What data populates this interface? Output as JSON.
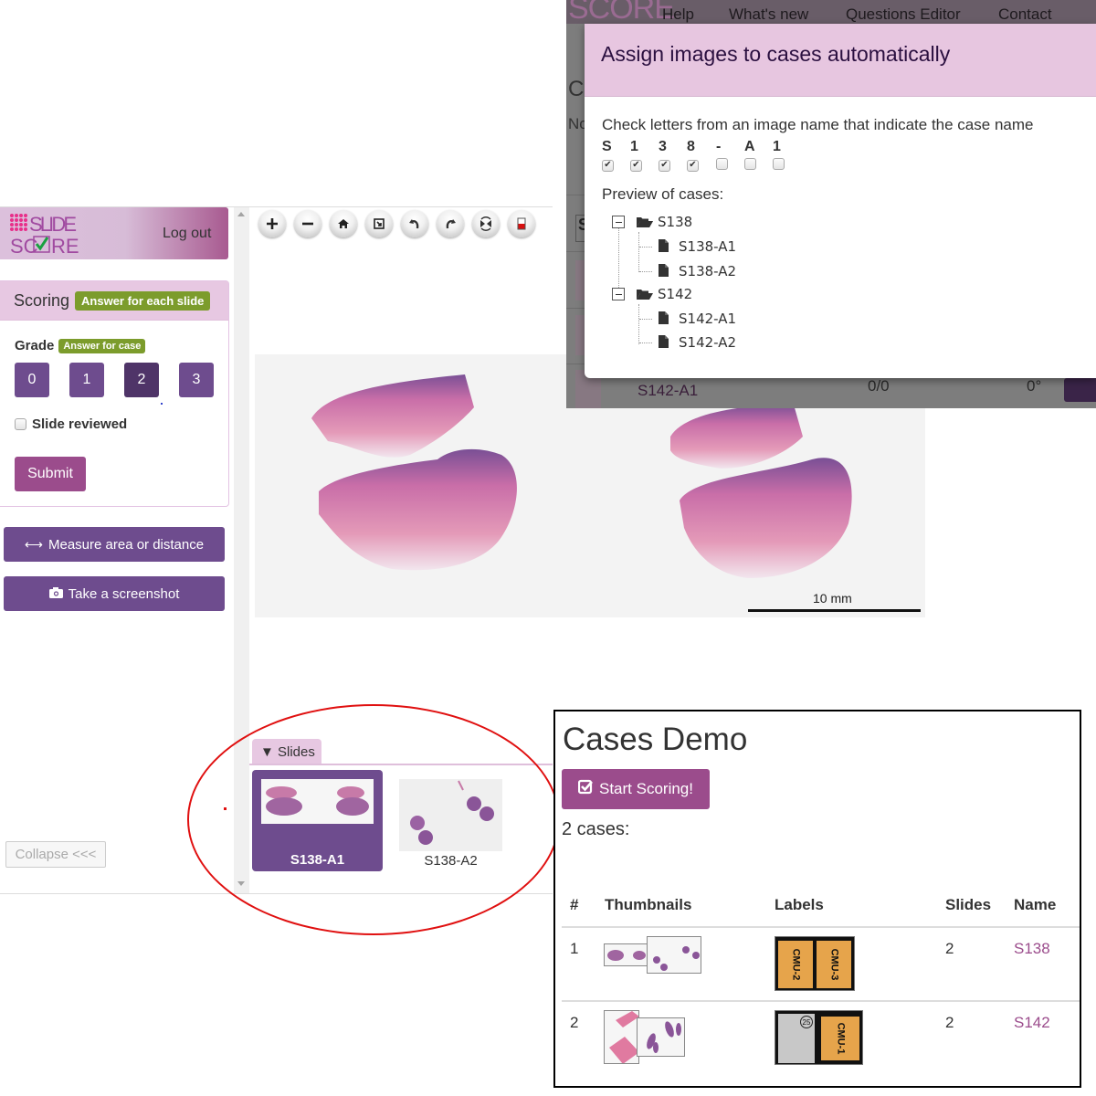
{
  "app": {
    "logo_line1": "SLIDE",
    "logo_line2": "SCORE",
    "logout": "Log out",
    "scoring": {
      "title": "Scoring",
      "badge": "Answer for each slide",
      "question_label": "Grade",
      "question_badge": "Answer for case",
      "grade_options": [
        "0",
        "1",
        "2",
        "3"
      ],
      "selected_grade": "2",
      "reviewed_label": "Slide reviewed",
      "reviewed_checked": false,
      "submit": "Submit"
    },
    "measure_button": "Measure area or distance",
    "screenshot_button": "Take a screenshot",
    "collapse_button": "Collapse <<<",
    "viewer_tools": [
      "zoom-in",
      "zoom-out",
      "home",
      "fullscreen",
      "rotate-left",
      "rotate-right",
      "flip",
      "color-adjust"
    ],
    "scalebar_label": "10 mm",
    "slides_tab": "▼ Slides",
    "slides": [
      {
        "name": "S138-A1",
        "active": true
      },
      {
        "name": "S138-A2",
        "active": false
      }
    ]
  },
  "dialog": {
    "background": {
      "nav_items": [
        "Help",
        "What's new",
        "Questions Editor",
        "Contact"
      ],
      "heading_fragment": "C",
      "note_fragment": "No",
      "cell_fragment": "S",
      "row_name": "S142-A1",
      "row_score": "0/0",
      "row_angle": "0°"
    },
    "title": "Assign images to cases automatically",
    "instruction": "Check letters from an image name that indicate the case name",
    "letters": [
      {
        "char": "S",
        "checked": true
      },
      {
        "char": "1",
        "checked": true
      },
      {
        "char": "3",
        "checked": true
      },
      {
        "char": "8",
        "checked": true
      },
      {
        "char": "-",
        "checked": false
      },
      {
        "char": "A",
        "checked": false
      },
      {
        "char": "1",
        "checked": false
      }
    ],
    "preview_label": "Preview of cases:",
    "tree": [
      {
        "case": "S138",
        "images": [
          "S138-A1",
          "S138-A2"
        ]
      },
      {
        "case": "S142",
        "images": [
          "S142-A1",
          "S142-A2"
        ]
      }
    ]
  },
  "cases": {
    "title": "Cases Demo",
    "start_button": "Start Scoring!",
    "count": "2 cases:",
    "columns": [
      "#",
      "Thumbnails",
      "Labels",
      "Slides",
      "Name"
    ],
    "rows": [
      {
        "num": "1",
        "labels": [
          "CMU-2",
          "CMU-3"
        ],
        "slides": "2",
        "name": "S138"
      },
      {
        "num": "2",
        "labels": [
          "25",
          "CMU-1"
        ],
        "slides": "2",
        "name": "S142"
      }
    ]
  },
  "colors": {
    "brand_purple": "#6e4c8e",
    "brand_magenta": "#9b4c8c",
    "header_pink": "#e7c8e2",
    "badge_green": "#7c9c2c",
    "annotation_red": "#e01010"
  }
}
